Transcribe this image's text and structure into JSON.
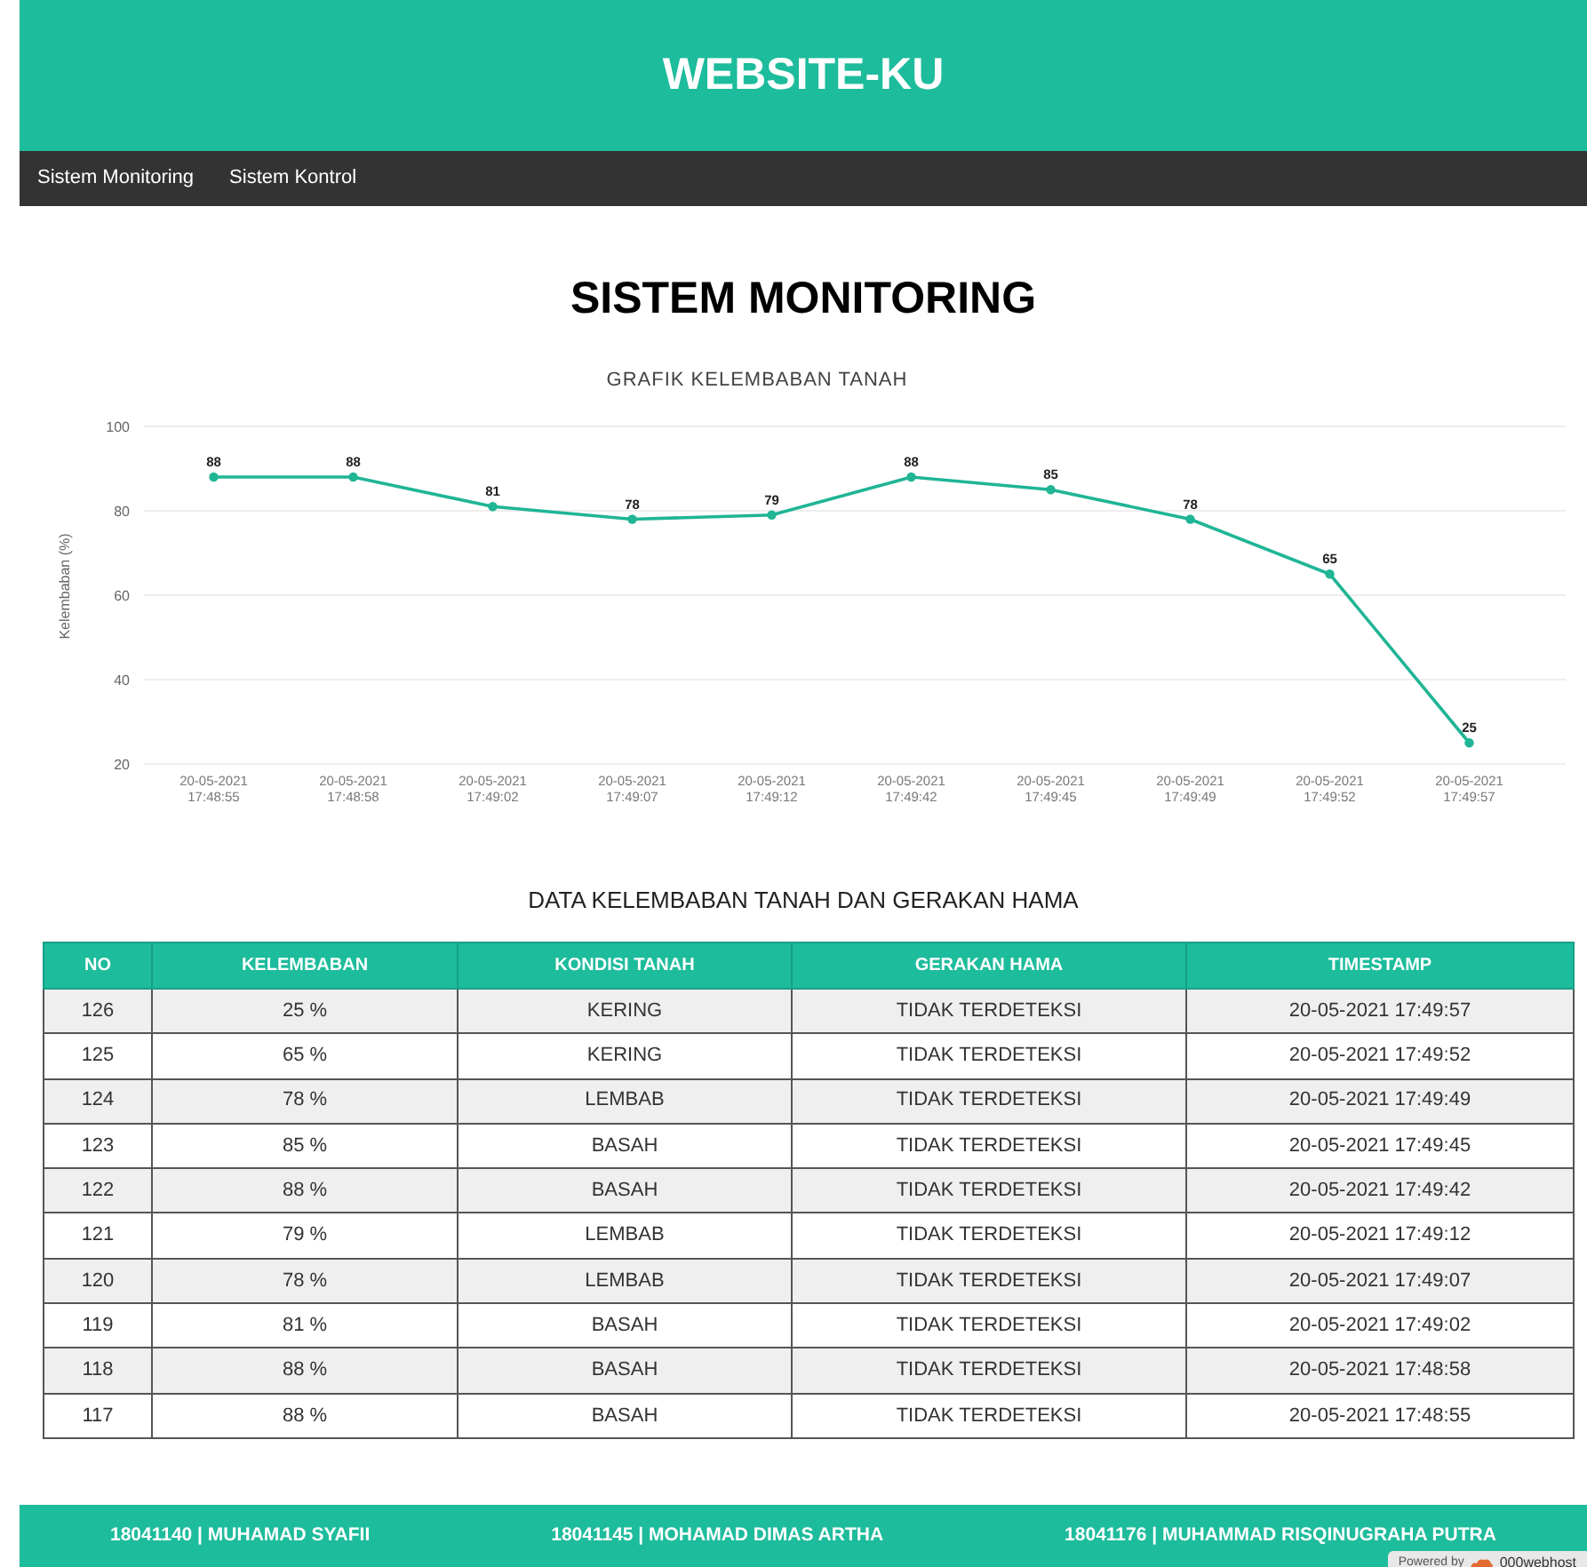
{
  "header": {
    "title": "WEBSITE-KU"
  },
  "nav": {
    "items": [
      {
        "label": "Sistem Monitoring"
      },
      {
        "label": "Sistem Kontrol"
      }
    ]
  },
  "page_title": "SISTEM MONITORING",
  "chart": {
    "chart_data": {
      "type": "line",
      "title": "GRAFIK KELEMBABAN TANAH",
      "ylabel": "Kelembaban (%)",
      "categories": [
        "20-05-2021 17:48:55",
        "20-05-2021 17:48:58",
        "20-05-2021 17:49:02",
        "20-05-2021 17:49:07",
        "20-05-2021 17:49:12",
        "20-05-2021 17:49:42",
        "20-05-2021 17:49:45",
        "20-05-2021 17:49:49",
        "20-05-2021 17:49:52",
        "20-05-2021 17:49:57"
      ],
      "series": [
        {
          "color": "#1fb595",
          "marker": true,
          "values": [
            88,
            88,
            81,
            78,
            79,
            88,
            85,
            78,
            65,
            25
          ]
        }
      ],
      "ylim": [
        20,
        100
      ],
      "yticks": [
        20,
        40,
        60,
        80,
        100
      ],
      "grid": true,
      "data_labels": true
    }
  },
  "table": {
    "title": "DATA KELEMBABAN TANAH DAN GERAKAN HAMA",
    "columns": [
      "NO",
      "KELEMBABAN",
      "KONDISI TANAH",
      "GERAKAN HAMA",
      "TIMESTAMP"
    ],
    "rows": [
      [
        "126",
        "25 %",
        "KERING",
        "TIDAK TERDETEKSI",
        "20-05-2021 17:49:57"
      ],
      [
        "125",
        "65 %",
        "KERING",
        "TIDAK TERDETEKSI",
        "20-05-2021 17:49:52"
      ],
      [
        "124",
        "78 %",
        "LEMBAB",
        "TIDAK TERDETEKSI",
        "20-05-2021 17:49:49"
      ],
      [
        "123",
        "85 %",
        "BASAH",
        "TIDAK TERDETEKSI",
        "20-05-2021 17:49:45"
      ],
      [
        "122",
        "88 %",
        "BASAH",
        "TIDAK TERDETEKSI",
        "20-05-2021 17:49:42"
      ],
      [
        "121",
        "79 %",
        "LEMBAB",
        "TIDAK TERDETEKSI",
        "20-05-2021 17:49:12"
      ],
      [
        "120",
        "78 %",
        "LEMBAB",
        "TIDAK TERDETEKSI",
        "20-05-2021 17:49:07"
      ],
      [
        "119",
        "81 %",
        "BASAH",
        "TIDAK TERDETEKSI",
        "20-05-2021 17:49:02"
      ],
      [
        "118",
        "88 %",
        "BASAH",
        "TIDAK TERDETEKSI",
        "20-05-2021 17:48:58"
      ],
      [
        "117",
        "88 %",
        "BASAH",
        "TIDAK TERDETEKSI",
        "20-05-2021 17:48:55"
      ]
    ]
  },
  "footer": {
    "items": [
      "18041140 | MUHAMAD SYAFII",
      "18041145 | MOHAMAD DIMAS ARTHA",
      "18041176 | MUHAMMAD RISQINUGRAHA PUTRA"
    ],
    "badge": {
      "prefix": "Powered by",
      "brand": "000webhost"
    }
  }
}
